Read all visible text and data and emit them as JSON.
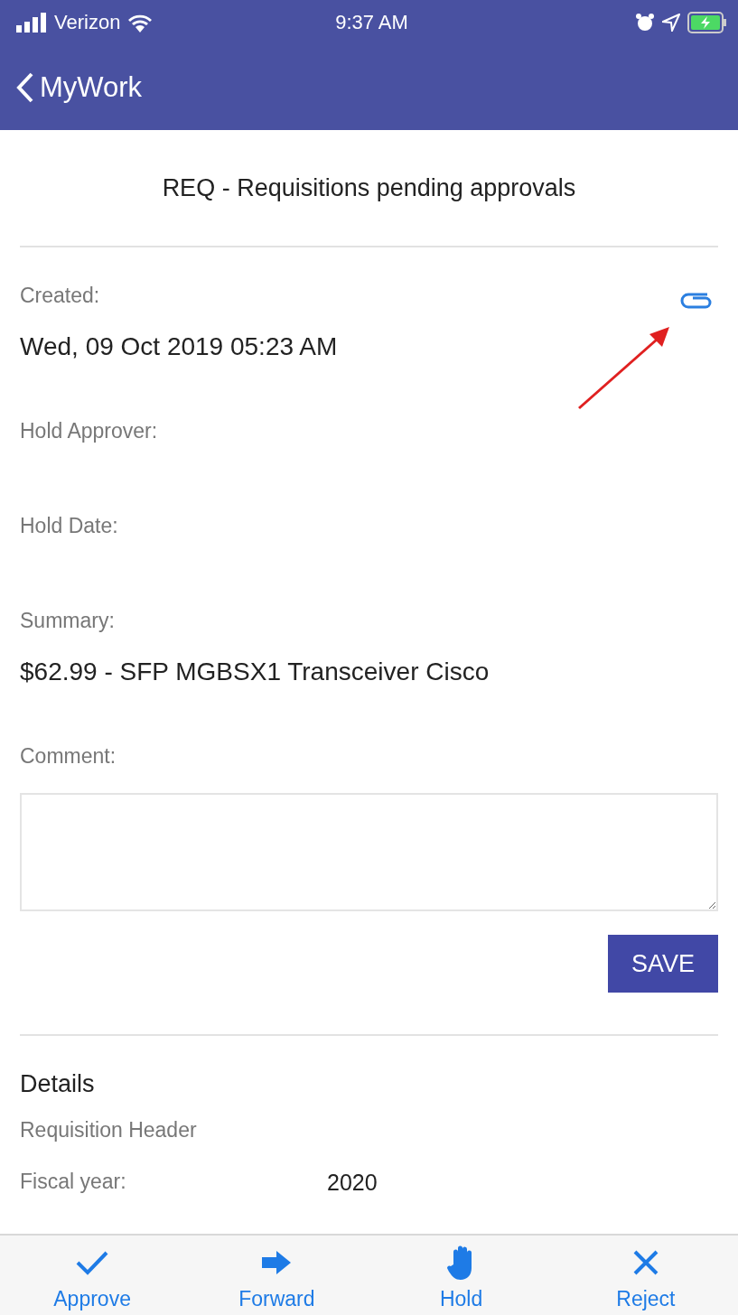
{
  "status_bar": {
    "carrier": "Verizon",
    "time": "9:37 AM"
  },
  "nav_bar": {
    "back_label": "MyWork"
  },
  "title": "REQ - Requisitions pending approvals",
  "fields": [
    {
      "label": "Created:",
      "value": "Wed, 09 Oct 2019 05:23 AM",
      "attachment": true
    },
    {
      "label": "Hold Approver:"
    },
    {
      "label": "Hold Date:"
    },
    {
      "label": "Summary:",
      "value": "$62.99 - SFP MGBSX1 Transceiver Cisco"
    }
  ],
  "comment": {
    "label": "Comment:",
    "save_button": "SAVE"
  },
  "details": {
    "heading": "Details",
    "section": "Requisition Header",
    "rows": [
      {
        "label": "Fiscal year:",
        "value": "2020"
      }
    ]
  },
  "actions": [
    {
      "kind": "approve",
      "label": "Approve"
    },
    {
      "kind": "forward",
      "label": "Forward"
    },
    {
      "kind": "hold",
      "label": "Hold"
    },
    {
      "kind": "reject",
      "label": "Reject"
    }
  ]
}
